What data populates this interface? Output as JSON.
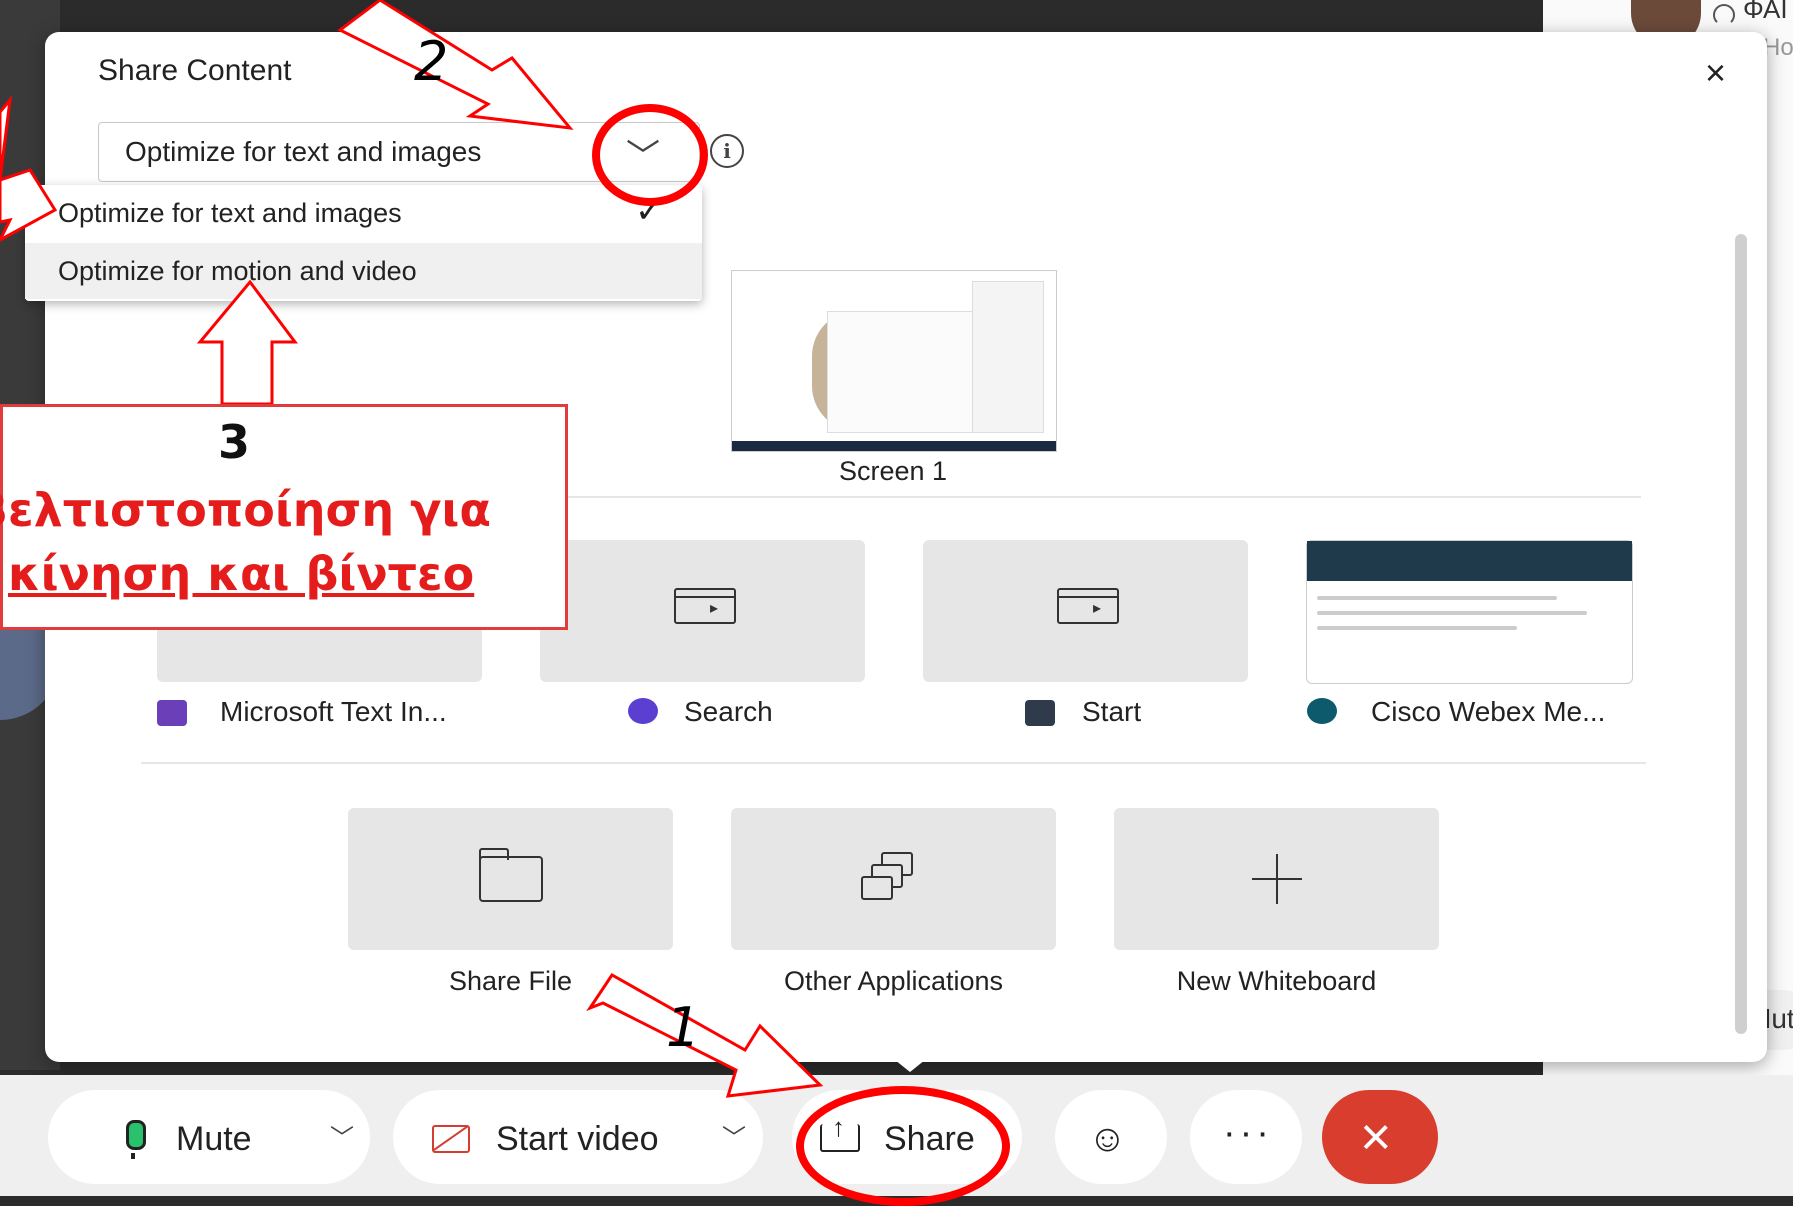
{
  "header_right": {
    "name": "ΦΑΙ",
    "role": "Host"
  },
  "dialog": {
    "title": "Share Content",
    "close_glyph": "×",
    "select_value": "Optimize for text and images",
    "dropdown": [
      {
        "label": "Optimize for text and images",
        "selected": true
      },
      {
        "label": "Optimize for motion and video",
        "selected": false
      }
    ],
    "screen_label": "Screen 1",
    "apps": [
      {
        "label": "Microsoft Text In...",
        "icon": "keyboard-icon"
      },
      {
        "label": "Search",
        "icon": "search-icon"
      },
      {
        "label": "Start",
        "icon": "start-icon"
      },
      {
        "label": "Cisco Webex Me...",
        "icon": "webex-icon"
      }
    ],
    "actions": [
      {
        "label": "Share File",
        "icon": "folder-icon"
      },
      {
        "label": "Other Applications",
        "icon": "windows-stack-icon"
      },
      {
        "label": "New Whiteboard",
        "icon": "plus-icon"
      }
    ]
  },
  "toolbar": {
    "mute": "Mute",
    "start_video": "Start video",
    "share": "Share",
    "more_glyph": "···",
    "end_glyph": "×"
  },
  "side_mute": "Mute",
  "annotations": {
    "step1": "1",
    "step2": "2",
    "step3": "3",
    "callout_line1": "Βελτιστοποίηση για",
    "callout_line2": "κίνηση και βίντεο"
  },
  "colors": {
    "annotation_red": "#ff0000",
    "end_call_red": "#d93d2e",
    "mic_green": "#29c16b"
  }
}
